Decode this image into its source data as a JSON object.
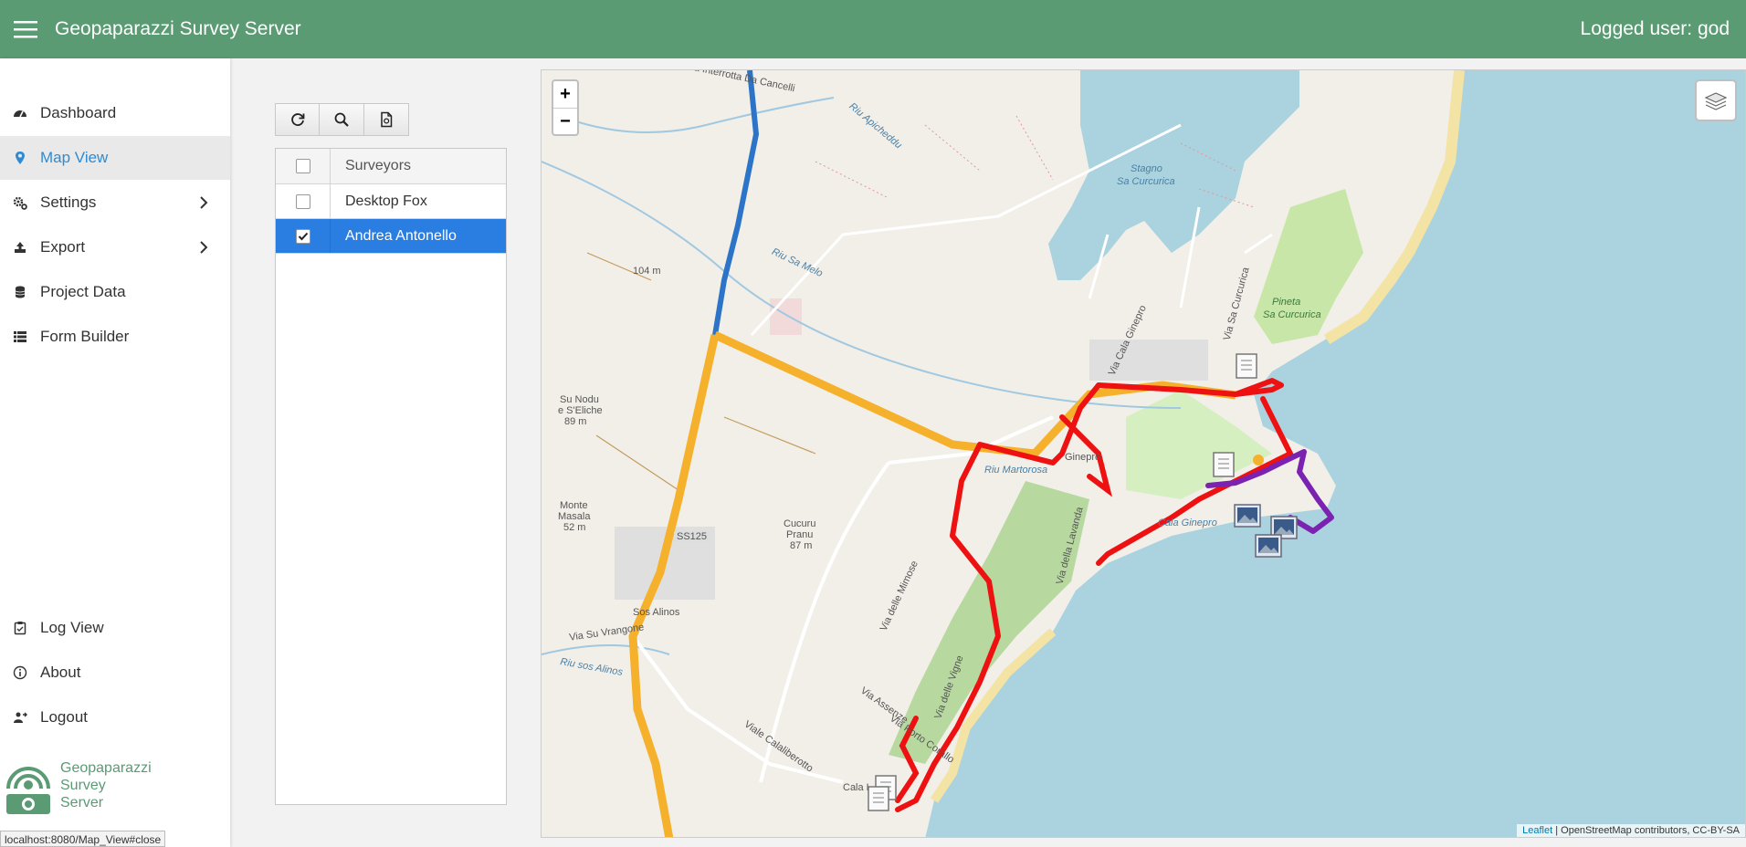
{
  "header": {
    "app_title": "Geopaparazzi Survey Server",
    "logged_user": "Logged user: god",
    "accent_color": "#5a9b73"
  },
  "sidebar": {
    "items": [
      {
        "label": "Dashboard",
        "icon": "dashboard-icon"
      },
      {
        "label": "Map View",
        "icon": "map-pin-icon",
        "active": true
      },
      {
        "label": "Settings",
        "icon": "gears-icon",
        "has_submenu": true
      },
      {
        "label": "Export",
        "icon": "export-icon",
        "has_submenu": true
      },
      {
        "label": "Project Data",
        "icon": "database-icon"
      },
      {
        "label": "Form Builder",
        "icon": "list-icon"
      },
      {
        "label": "Log View",
        "icon": "clipboard-icon"
      },
      {
        "label": "About",
        "icon": "info-icon"
      },
      {
        "label": "Logout",
        "icon": "logout-icon"
      }
    ],
    "brand": [
      "Geopaparazzi",
      "Survey",
      "Server"
    ]
  },
  "status_bar_url": "localhost:8080/Map_View#close",
  "toolbar": {
    "buttons": [
      {
        "name": "refresh",
        "icon": "refresh-icon"
      },
      {
        "name": "zoom-to",
        "icon": "search-icon"
      },
      {
        "name": "export-document",
        "icon": "document-icon"
      }
    ]
  },
  "surveyors": {
    "header": "Surveyors",
    "rows": [
      {
        "name": "Desktop Fox",
        "checked": false,
        "selected": false
      },
      {
        "name": "Andrea Antonello",
        "checked": true,
        "selected": true
      }
    ]
  },
  "map": {
    "zoom_in": "+",
    "zoom_out": "−",
    "attribution_leaflet": "Leaflet",
    "attribution_rest": " | OpenStreetMap contributors, CC-BY-SA",
    "labels": [
      "Strada Interrotta Da Cancelli",
      "Riu Apicheddu",
      "Stagno",
      "Sa Curcurica",
      "Pineta",
      "Sa Curcurica",
      "Via Sa Curcurica",
      "Via Cala Ginepro",
      "104 m",
      "Riu Sa Melo",
      "Su Nodu",
      "e S'Eliche",
      "89 m",
      "Riu Martorosa",
      "Ginepro",
      "Monte",
      "Masala",
      "52 m",
      "Cucuru",
      "Pranu",
      "87 m",
      "SS125",
      "Sos Alinos",
      "Riu sos Alinos",
      "Via Su Vrangone",
      "Via delle Mimose",
      "Via delle Vigne",
      "Via Assenze",
      "Via Porto Corallo",
      "Viale Calaliberotto",
      "Via della Lavanda",
      "Cala Ginepro",
      "Cala L"
    ],
    "track_colors": {
      "red": "#ee1111",
      "purple": "#7b22b0",
      "orange": "#f6b12c",
      "blue": "#2c74c8",
      "sea": "#aad3df"
    }
  }
}
